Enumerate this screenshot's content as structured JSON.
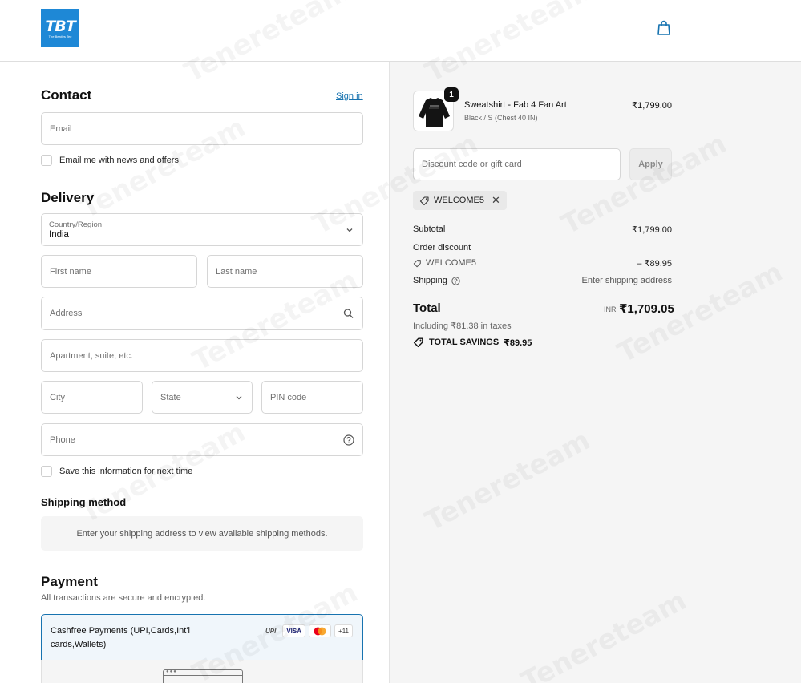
{
  "header": {
    "logo_mark": "TBT",
    "logo_tagline": "The Beatles Tee",
    "cart_icon": "shopping-bag-icon"
  },
  "contact": {
    "title": "Contact",
    "sign_in_label": "Sign in",
    "email_placeholder": "Email",
    "newsletter_label": "Email me with news and offers"
  },
  "delivery": {
    "title": "Delivery",
    "country_label": "Country/Region",
    "country_value": "India",
    "first_name_placeholder": "First name",
    "last_name_placeholder": "Last name",
    "address_placeholder": "Address",
    "apartment_placeholder": "Apartment, suite, etc.",
    "city_placeholder": "City",
    "state_placeholder": "State",
    "pin_placeholder": "PIN code",
    "phone_placeholder": "Phone",
    "save_info_label": "Save this information for next time"
  },
  "shipping_method": {
    "title": "Shipping method",
    "notice": "Enter your shipping address to view available shipping methods."
  },
  "payment": {
    "title": "Payment",
    "subtitle": "All transactions are secure and encrypted.",
    "option_label": "Cashfree Payments (UPI,Cards,Int'l cards,Wallets)",
    "logos": [
      "UPI",
      "VISA",
      "mastercard",
      "+11"
    ]
  },
  "summary": {
    "product": {
      "quantity": "1",
      "name": "Sweatshirt - Fab 4 Fan Art",
      "variant": "Black / S (Chest 40 IN)",
      "price": "₹1,799.00"
    },
    "discount_placeholder": "Discount code or gift card",
    "apply_label": "Apply",
    "applied_code": "WELCOME5",
    "subtotal_label": "Subtotal",
    "subtotal_value": "₹1,799.00",
    "order_discount_label": "Order discount",
    "discount_code": "WELCOME5",
    "discount_value": "– ₹89.95",
    "shipping_label": "Shipping",
    "shipping_value": "Enter shipping address",
    "total_label": "Total",
    "total_currency": "INR",
    "total_value": "₹1,709.05",
    "tax_note": "Including ₹81.38 in taxes",
    "savings_label": "TOTAL SAVINGS",
    "savings_value": "₹89.95"
  },
  "colors": {
    "link": "#1773b0",
    "logo_bg": "#1e88d6",
    "summary_bg": "#f5f5f5"
  },
  "watermark": "Tenereteam"
}
